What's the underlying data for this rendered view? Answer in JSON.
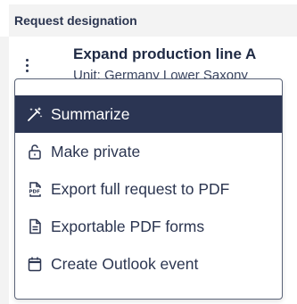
{
  "table": {
    "header": "Request designation"
  },
  "row": {
    "title": "Expand production line A",
    "subtitle": "Unit: Germany Lower Saxony"
  },
  "menu": {
    "items": [
      {
        "label": "Summarize",
        "icon": "magic-wand-icon",
        "active": true
      },
      {
        "label": "Make private",
        "icon": "lock-icon",
        "active": false
      },
      {
        "label": "Export full request to PDF",
        "icon": "pdf-file-icon",
        "active": false
      },
      {
        "label": "Exportable PDF forms",
        "icon": "document-icon",
        "active": false
      },
      {
        "label": "Create Outlook event",
        "icon": "calendar-icon",
        "active": false
      }
    ]
  },
  "colors": {
    "accent": "#2b3553",
    "text": "#2b3550",
    "header_bg": "#f3f3f3"
  }
}
